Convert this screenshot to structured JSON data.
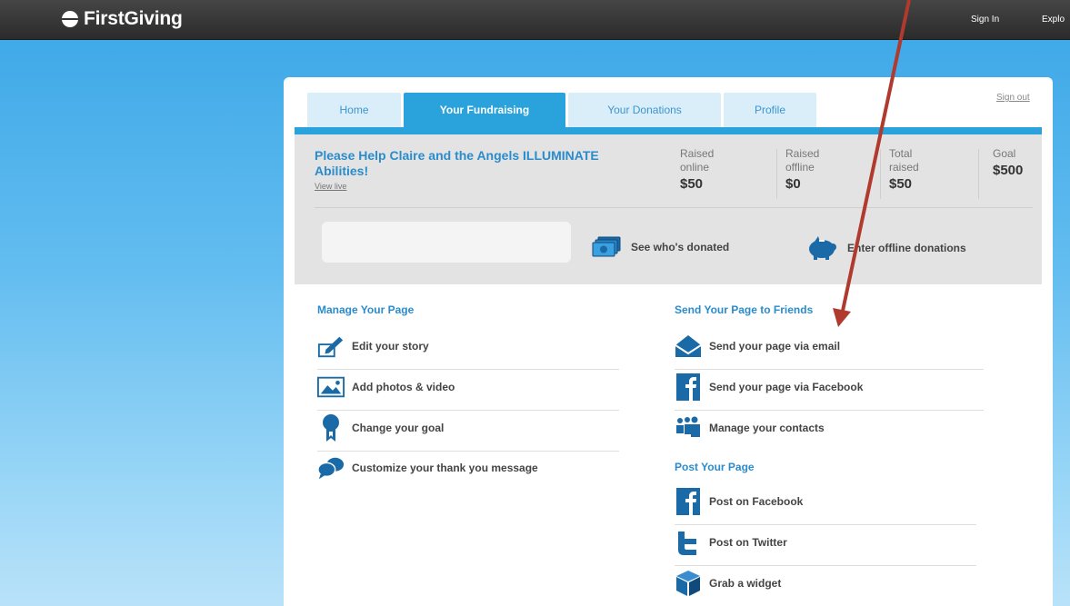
{
  "topbar": {
    "logo": "FirstGiving",
    "signin": "Sign In",
    "explore": "Explo"
  },
  "tabs": [
    {
      "label": "Home"
    },
    {
      "label": "Your Fundraising"
    },
    {
      "label": "Your Donations"
    },
    {
      "label": "Profile"
    }
  ],
  "signout": "Sign out",
  "campaign": {
    "title": "Please Help Claire and the Angels ILLUMINATE Abilities!",
    "view_live": "View live"
  },
  "stats": {
    "raised_online": {
      "label": "Raised online",
      "value": "$50"
    },
    "raised_offline": {
      "label": "Raised offline",
      "value": "$0"
    },
    "total_raised": {
      "label": "Total raised",
      "value": "$50"
    },
    "goal": {
      "label": "Goal",
      "value": "$500"
    }
  },
  "panel_actions": {
    "see_donated": "See who's donated",
    "offline_donations": "Enter offline donations"
  },
  "manage": {
    "heading": "Manage Your Page",
    "items": [
      {
        "label": "Edit your story",
        "icon": "pencil-icon"
      },
      {
        "label": "Add photos & video",
        "icon": "photo-icon"
      },
      {
        "label": "Change your goal",
        "icon": "ribbon-icon"
      },
      {
        "label": "Customize your thank you message",
        "icon": "speech-bubbles-icon"
      }
    ]
  },
  "send": {
    "heading": "Send Your Page to Friends",
    "items": [
      {
        "label": "Send your page via email",
        "icon": "envelope-icon"
      },
      {
        "label": "Send your page via Facebook",
        "icon": "facebook-icon"
      },
      {
        "label": "Manage your contacts",
        "icon": "contacts-icon"
      }
    ]
  },
  "post": {
    "heading": "Post Your Page",
    "items": [
      {
        "label": "Post on Facebook",
        "icon": "facebook-icon"
      },
      {
        "label": "Post on Twitter",
        "icon": "twitter-icon"
      },
      {
        "label": "Grab a widget",
        "icon": "box-icon"
      }
    ]
  },
  "colors": {
    "accent_blue": "#2aa3dd",
    "link_blue": "#2a8ccc",
    "icon_blue": "#1a6aa8",
    "annotation_arrow": "#b03a2e"
  }
}
